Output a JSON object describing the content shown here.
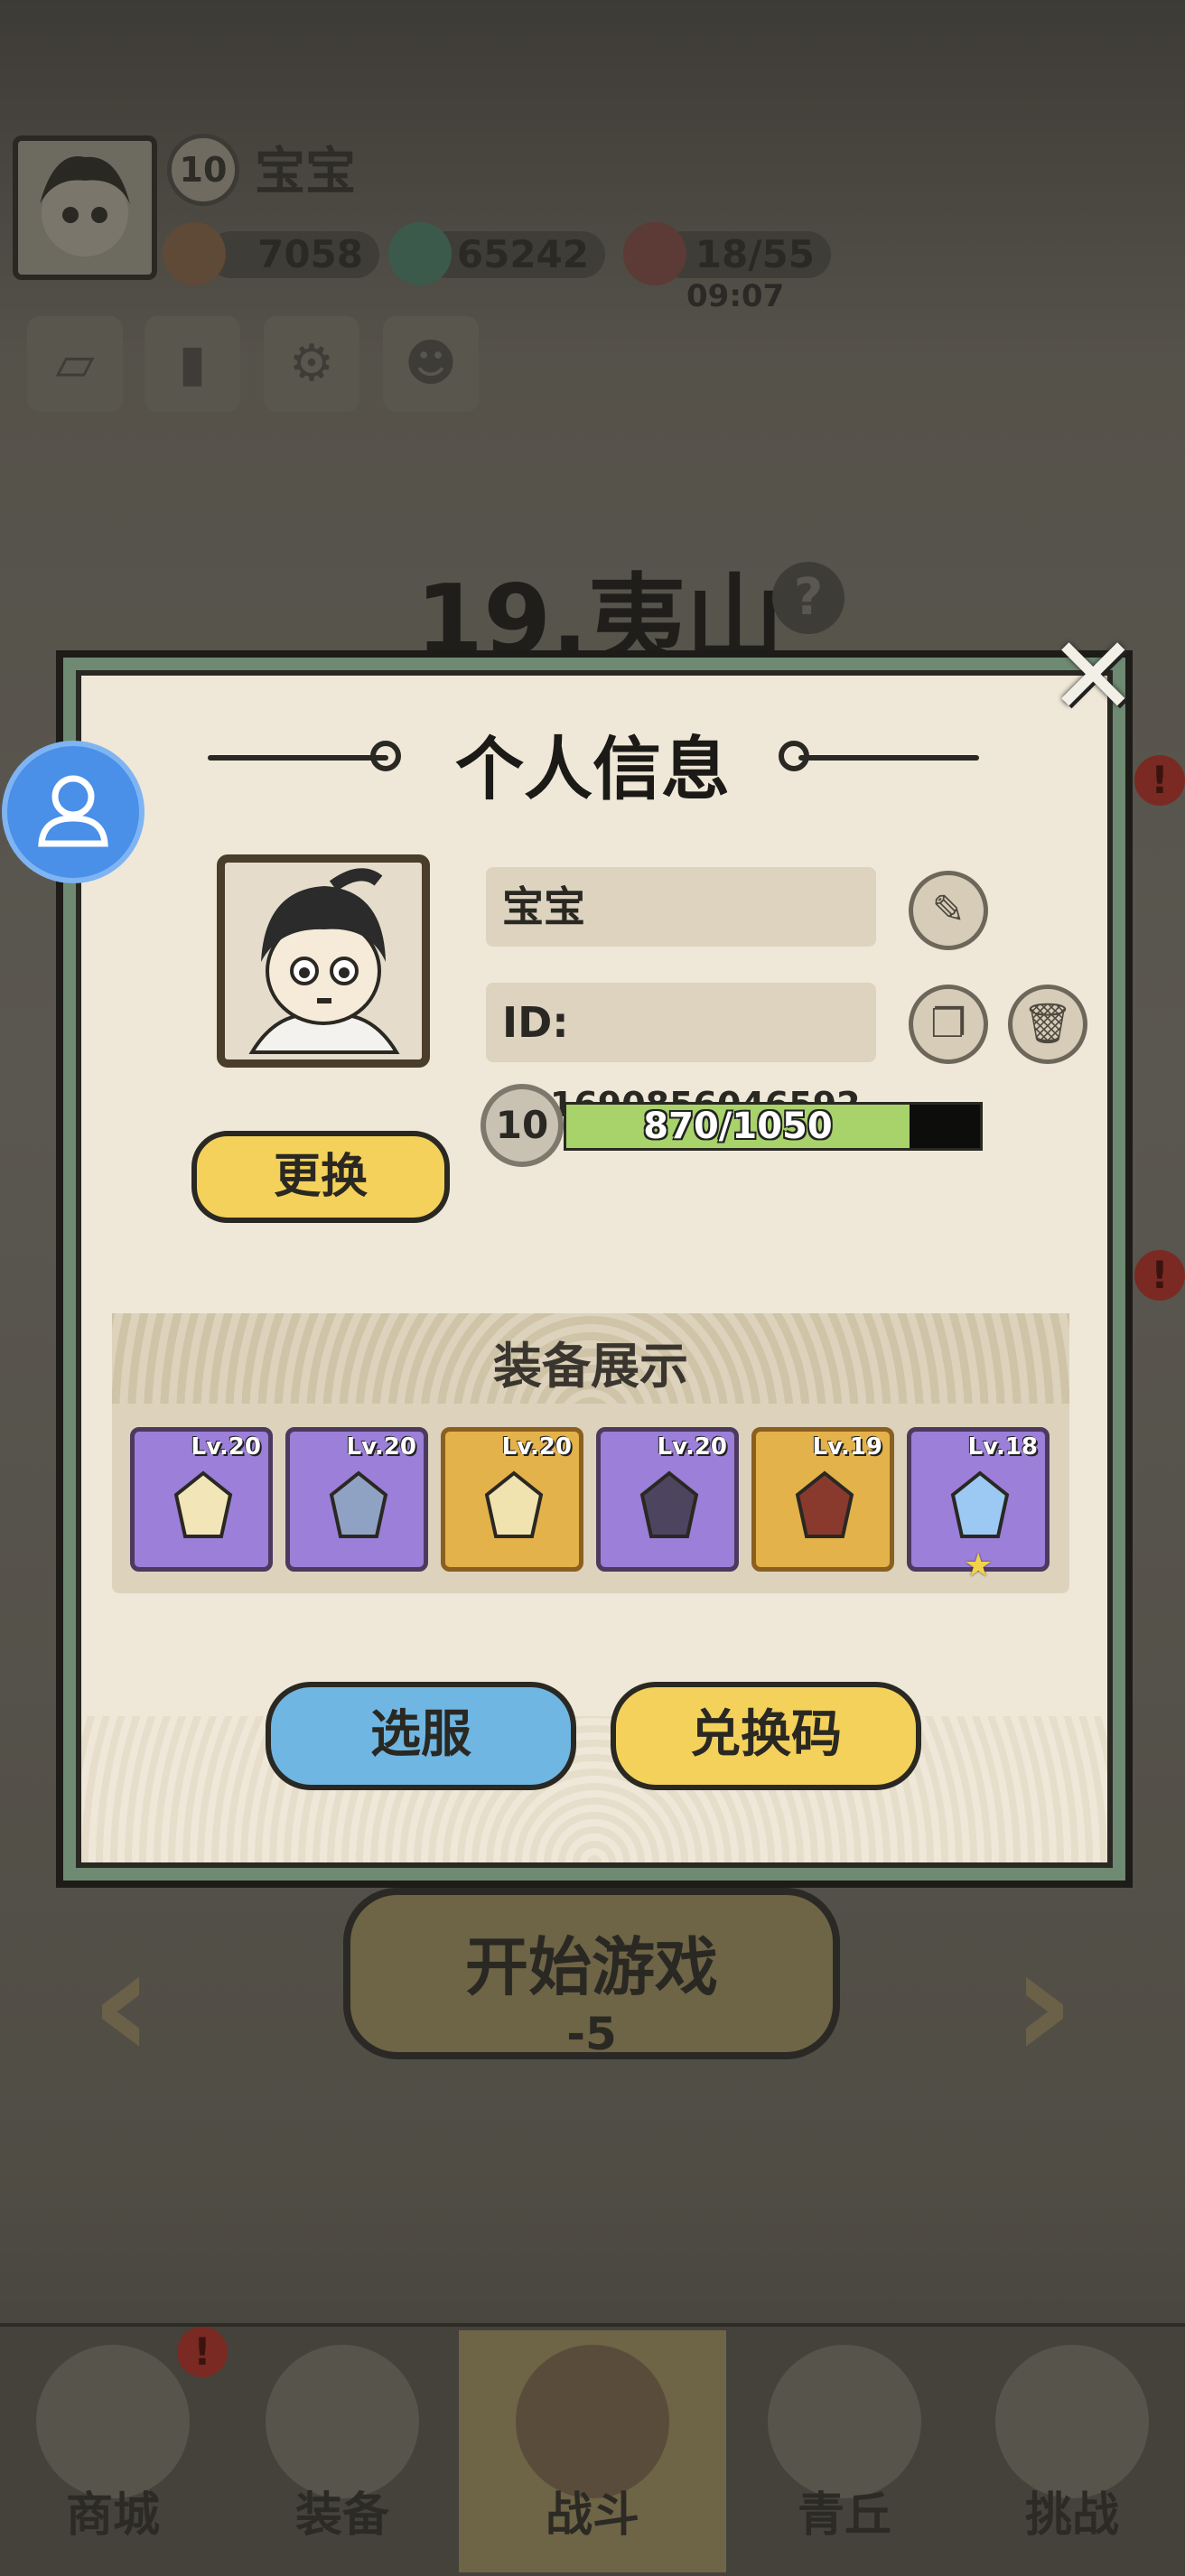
{
  "hud": {
    "level": "10",
    "player_name": "宝宝",
    "currency1": "7058",
    "currency2": "65242",
    "stamina": "18/55",
    "stamina_timer": "09:07"
  },
  "stage": {
    "title": "19.夷山",
    "help": "?"
  },
  "start": {
    "label": "开始游戏",
    "cost": "-5"
  },
  "nav": {
    "items": [
      {
        "label": "商城"
      },
      {
        "label": "装备"
      },
      {
        "label": "战斗"
      },
      {
        "label": "青丘"
      },
      {
        "label": "挑战"
      }
    ],
    "active": "战斗"
  },
  "dialog": {
    "title": "个人信息",
    "close": "✕",
    "name": "宝宝",
    "id_label": "ID:",
    "id_value": "551690856046592",
    "level": "10",
    "xp_text": "870/1050",
    "xp_fraction": 0.83,
    "change_label": "更换",
    "equip_title": "装备展示",
    "equipment": [
      {
        "level": "Lv.20",
        "rarity": "purple",
        "item": "whip"
      },
      {
        "level": "Lv.20",
        "rarity": "purple",
        "item": "armor"
      },
      {
        "level": "Lv.20",
        "rarity": "gold",
        "item": "gloves"
      },
      {
        "level": "Lv.20",
        "rarity": "purple",
        "item": "belt"
      },
      {
        "level": "Lv.19",
        "rarity": "gold",
        "item": "boots"
      },
      {
        "level": "Lv.18",
        "rarity": "purple",
        "item": "gem",
        "starred": true
      }
    ],
    "server_label": "选服",
    "redeem_label": "兑换码"
  },
  "colors": {
    "dialog_bg": "#efe8d8",
    "yellow_button": "#f4d15a",
    "blue_button": "#6fb6e2",
    "purple_slot": "#9b7fd8",
    "gold_slot": "#e3b24a",
    "xp_fill": "#a8d26a"
  }
}
